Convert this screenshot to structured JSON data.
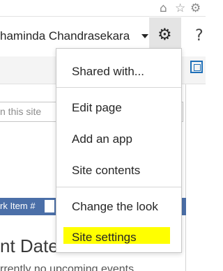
{
  "browser": {
    "icons": [
      "home-icon",
      "star-icon",
      "gear-icon"
    ],
    "home_glyph": "⌂",
    "star_glyph": "☆",
    "gear_glyph": "⚙"
  },
  "suite_bar": {
    "user_name": "haminda Chandrasekara",
    "gear_glyph": "⚙",
    "help_glyph": "?"
  },
  "page": {
    "search_placeholder": "n this site",
    "blue_bar_label": "rk Item #",
    "section_heading": "nt Dates",
    "events_text": "rrently no upcoming events"
  },
  "settings_menu": {
    "items": [
      {
        "label": "Shared with..."
      },
      {
        "label": "Edit page"
      },
      {
        "label": "Add an app"
      },
      {
        "label": "Site contents"
      },
      {
        "label": "Change the look"
      },
      {
        "label": "Site settings",
        "highlighted": true
      }
    ]
  },
  "colors": {
    "accent_blue": "#4b6fa8",
    "highlight": "#ffff00",
    "gear_button_bg": "#e4e4e4"
  }
}
